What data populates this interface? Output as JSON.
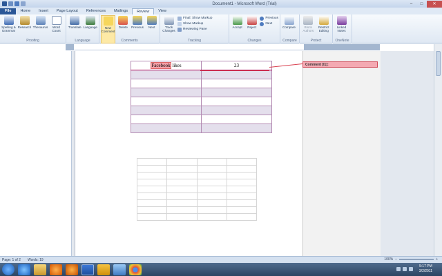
{
  "window": {
    "title": "Document1 - Microsoft Word (Trial)"
  },
  "tabs": [
    "File",
    "Home",
    "Insert",
    "Page Layout",
    "References",
    "Mailings",
    "Review",
    "View"
  ],
  "active_tab": "Review",
  "ribbon": {
    "proofing": {
      "label": "Proofing",
      "buttons": [
        "Spelling & Grammar",
        "Research",
        "Thesaurus",
        "Word Count"
      ]
    },
    "language": {
      "label": "Language",
      "buttons": [
        "Translate",
        "Language"
      ]
    },
    "comments": {
      "label": "Comments",
      "buttons": [
        "New Comment",
        "Delete",
        "Previous",
        "Next"
      ]
    },
    "tracking": {
      "label": "Tracking",
      "track_changes": "Track Changes",
      "display_for_review": "Final: Show Markup",
      "show_markup": "Show Markup",
      "reviewing_pane": "Reviewing Pane"
    },
    "changes": {
      "label": "Changes",
      "accept": "Accept",
      "reject": "Reject",
      "previous": "Previous",
      "next": "Next"
    },
    "compare": {
      "label": "Compare",
      "button": "Compare"
    },
    "protect": {
      "label": "Protect",
      "buttons": [
        "Block Authors",
        "Restrict Editing"
      ]
    },
    "onenote": {
      "label": "OneNote",
      "button": "Linked Notes"
    }
  },
  "document": {
    "table1": {
      "header": [
        "Facebook likes",
        "23"
      ],
      "highlighted_word": "Facebook",
      "rest_of_cell": " likes",
      "empty_rows": 7
    },
    "table2": {
      "rows": 9,
      "cols": 4
    },
    "comment": "Comment [l1]:"
  },
  "status": {
    "page": "Page: 1 of 2",
    "words": "Words: 19",
    "zoom": "100%"
  },
  "clock": {
    "time": "5:17 PM",
    "date": "3/2/2011"
  },
  "colors": {
    "file_tab": "#2b5797",
    "comment": "#f4a9b2",
    "table_band": "#e4dfec"
  }
}
